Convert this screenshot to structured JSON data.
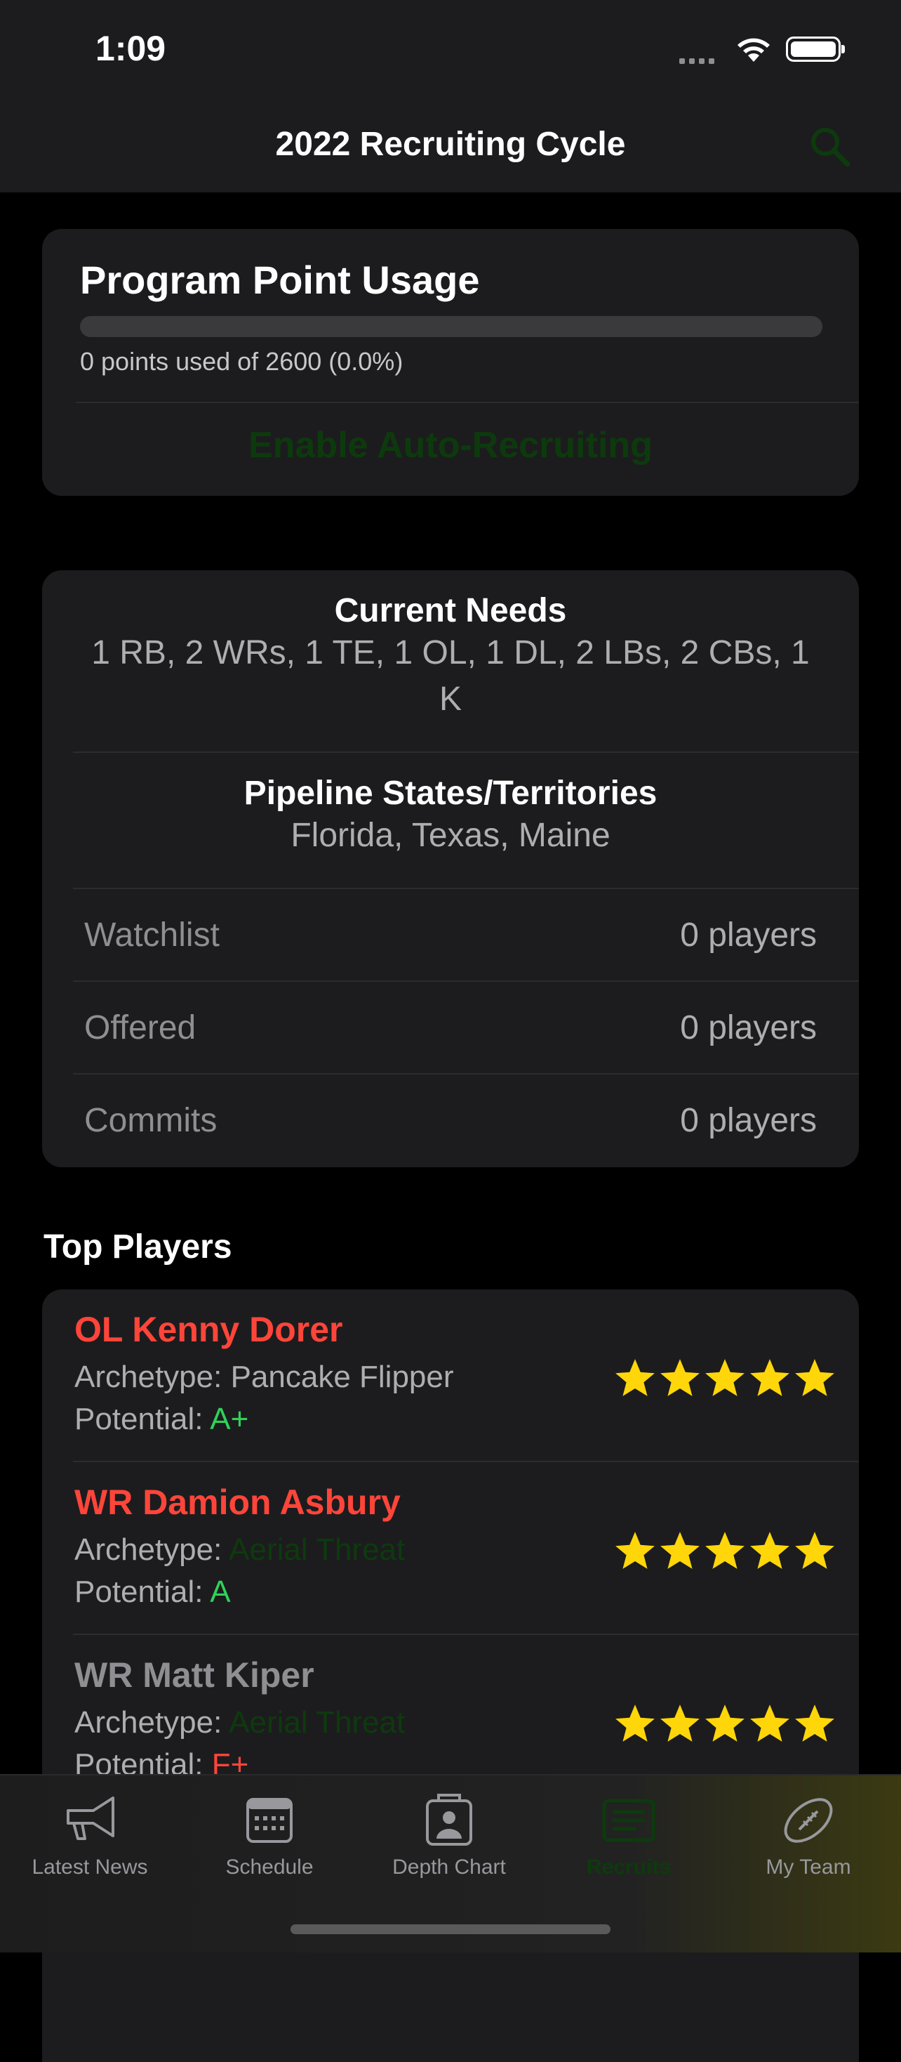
{
  "status": {
    "time": "1:09"
  },
  "nav": {
    "title": "2022 Recruiting Cycle"
  },
  "colors": {
    "accent_dark_green": "#0d3a0d",
    "red_name": "#ff453a",
    "green_grade": "#30d158",
    "red_grade": "#ff453a",
    "star_yellow": "#ffd60a"
  },
  "point_usage": {
    "title": "Program Point Usage",
    "progress_percent": 0,
    "summary": "0 points used of 2600 (0.0%)",
    "auto_button": "Enable Auto-Recruiting"
  },
  "needs": {
    "title": "Current Needs",
    "value": "1 RB, 2 WRs, 1 TE, 1 OL, 1 DL, 2 LBs, 2 CBs, 1 K"
  },
  "pipeline": {
    "title": "Pipeline States/Territories",
    "value": "Florida, Texas, Maine"
  },
  "rows": [
    {
      "label": "Watchlist",
      "value": "0 players"
    },
    {
      "label": "Offered",
      "value": "0 players"
    },
    {
      "label": "Commits",
      "value": "0 players"
    }
  ],
  "top_players": {
    "header": "Top Players",
    "archetype_label": "Archetype:",
    "potential_label": "Potential:",
    "players": [
      {
        "name": "OL Kenny Dorer",
        "archetype": "Pancake Flipper",
        "potential": "A+",
        "stars": 5
      },
      {
        "name": "WR Damion Asbury",
        "archetype": "Aerial Threat",
        "potential": "A",
        "stars": 5
      },
      {
        "name": "WR Matt Kiper",
        "archetype": "Aerial Threat",
        "potential": "F+",
        "stars": 5
      }
    ]
  },
  "tabs": [
    {
      "label": "Latest News",
      "icon": "megaphone-icon"
    },
    {
      "label": "Schedule",
      "icon": "calendar-icon"
    },
    {
      "label": "Depth Chart",
      "icon": "clipboard-person-icon"
    },
    {
      "label": "Recruits",
      "icon": "list-icon",
      "selected": true
    },
    {
      "label": "My Team",
      "icon": "football-icon"
    }
  ]
}
